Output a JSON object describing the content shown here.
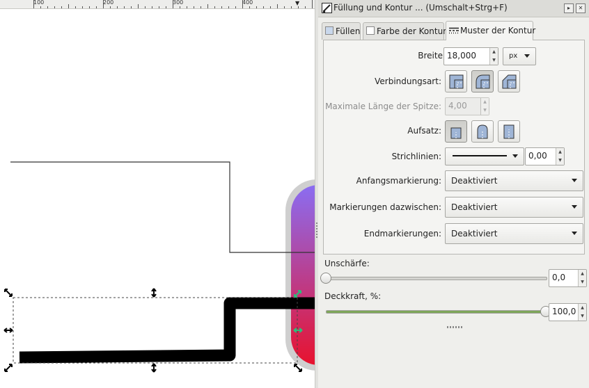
{
  "ruler": {
    "labels": [
      "100",
      "200",
      "300",
      "400"
    ]
  },
  "canvas": {
    "gradient_colors": {
      "top": "#8a6df2",
      "bottom": "#e8122e"
    },
    "handle_colors": {
      "scale": "#000000",
      "active": "#2bbf7a"
    },
    "icons": [
      "scale-arrow-icon",
      "rotate-arrow-icon"
    ]
  },
  "dialog": {
    "title": "Füllung und Kontur ... (Umschalt+Strg+F)",
    "tabs": [
      {
        "label": "Füllen",
        "icon": "fill-icon"
      },
      {
        "label": "Farbe der Kontur",
        "icon": "stroke-paint-icon"
      },
      {
        "label": "Muster der Kontur",
        "icon": "stroke-style-icon"
      }
    ],
    "active_tab": 2,
    "stroke_style": {
      "width_label": "Breite:",
      "width_value": "18,000",
      "unit": "px",
      "join_label": "Verbindungsart:",
      "join_options": [
        "miter-join-icon",
        "round-join-icon",
        "bevel-join-icon"
      ],
      "join_selected": 1,
      "miter_label": "Maximale Länge der Spitze:",
      "miter_value": "4,00",
      "cap_label": "Aufsatz:",
      "cap_options": [
        "butt-cap-icon",
        "round-cap-icon",
        "square-cap-icon"
      ],
      "cap_selected": 0,
      "dash_label": "Strichlinien:",
      "dash_offset": "0,00",
      "start_marker_label": "Anfangsmarkierung:",
      "start_marker_value": "Deaktiviert",
      "mid_marker_label": "Markierungen dazwischen:",
      "mid_marker_value": "Deaktiviert",
      "end_marker_label": "Endmarkierungen:",
      "end_marker_value": "Deaktiviert"
    },
    "blur": {
      "label": "Unschärfe:",
      "value": "0,0",
      "fraction": 0.0
    },
    "opacity": {
      "label": "Deckkraft, %:",
      "value": "100,0",
      "fraction": 1.0
    },
    "colors": {
      "opacity_track": "#7ea65a"
    }
  }
}
